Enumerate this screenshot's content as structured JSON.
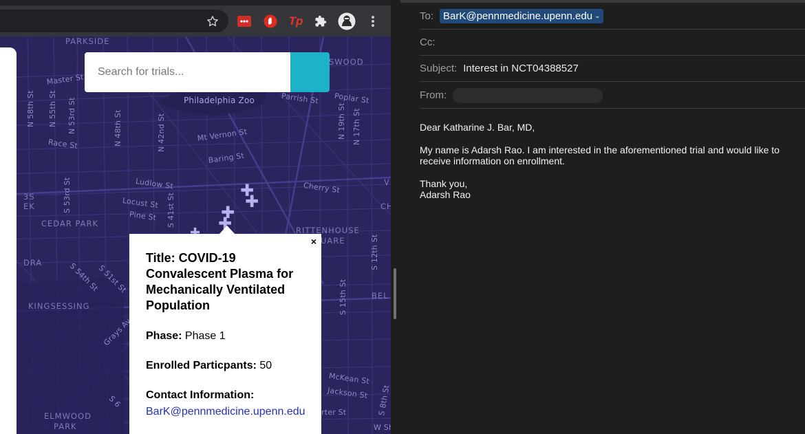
{
  "browser": {
    "toolbar": {
      "extensions": [
        "lastpass-extension",
        "block-extension",
        "tp-extension",
        "extensions-puzzle"
      ],
      "tp_label": "Tp"
    },
    "search": {
      "placeholder": "Search for trials..."
    },
    "map": {
      "zoo_label": "Philadelphia Zoo",
      "areas": [
        "PARKSIDE",
        "SWOOD",
        "CEDAR PARK",
        "RITTENHOUSE",
        "UARE",
        "KINGSESSING",
        "ELMWOOD",
        "PARK",
        "DRA",
        "BEL",
        "3S",
        "EK",
        "CH",
        "V"
      ],
      "streets": [
        "Master St",
        "Parrish St",
        "Poplar St",
        "N 58th St",
        "N 55th St",
        "N 53rd St",
        "N 48th St",
        "N 42nd St",
        "N 19th St",
        "N 17th St",
        "Race St",
        "Mt Vernon St",
        "Baring St",
        "Ludlow St",
        "Cherry St",
        "Locust St",
        "Pine St",
        "S 53rd St",
        "S 41st St",
        "S 54th St",
        "S 51st St",
        "Grays Ave",
        "S 6",
        "S 12th St",
        "S 15th St",
        "McKean St",
        "Jackson St",
        "S 8th St",
        "W Sh",
        "rter St"
      ]
    },
    "popup": {
      "close_label": "×",
      "title": "Title: COVID-19 Convalescent Plasma for Mechanically Ventilated Population",
      "phase_label": "Phase:",
      "phase_value": "Phase 1",
      "enrolled_label": "Enrolled Particpants:",
      "enrolled_value": "50",
      "contact_label": "Contact Information:",
      "contact_email": "BarK@pennmedicine.upenn.edu"
    }
  },
  "mail": {
    "to_label": "To:",
    "to_value": "BarK@pennmedicine.upenn.edu",
    "cc_label": "Cc:",
    "subject_label": "Subject:",
    "subject_value": "Interest in NCT04388527",
    "from_label": "From:",
    "body": {
      "greeting": "Dear Katharine J. Bar, MD,",
      "paragraph": "My name is Adarsh Rao. I am interested in the aforementioned trial and would like to receive information on enrollment.",
      "closing": "Thank you,",
      "signature": "Adarsh Rao"
    }
  },
  "colors": {
    "map_bg": "#2a255c",
    "map_lines": "#3d3780",
    "search_button": "#1eb2c9",
    "marker": "#b7b1f2",
    "link": "#2731b8",
    "chip": "#1f4a7a"
  }
}
